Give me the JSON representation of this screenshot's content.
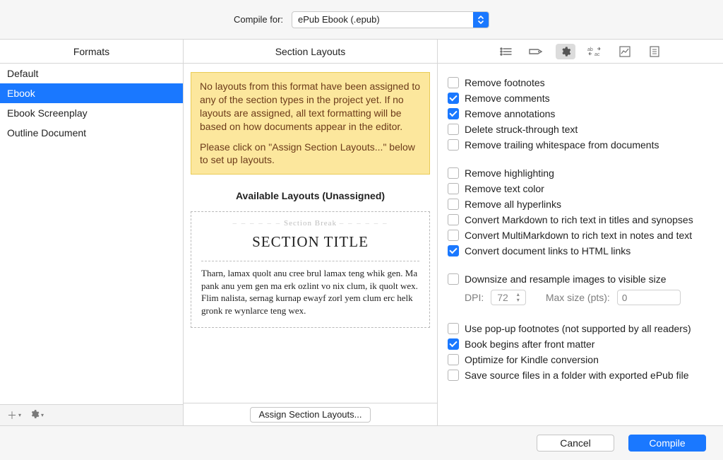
{
  "topbar": {
    "label": "Compile for:",
    "select_value": "ePub Ebook (.epub)"
  },
  "formats": {
    "header": "Formats",
    "items": [
      "Default",
      "Ebook",
      "Ebook Screenplay",
      "Outline Document"
    ],
    "selected_index": 1,
    "add_icon": "plus-icon",
    "gear_icon": "gear-icon"
  },
  "layouts": {
    "header": "Section Layouts",
    "warning_p1": "No layouts from this format have been assigned to any of the section types in the project yet. If no layouts are assigned, all text formatting will be based on how documents appear in the editor.",
    "warning_p2": "Please click on \"Assign Section Layouts...\" below to set up layouts.",
    "available_heading": "Available Layouts (Unassigned)",
    "section_break_label": "Section Break",
    "section_title": "SECTION TITLE",
    "lorem": "Tharn, lamax quolt anu cree brul lamax teng whik gen. Ma pank anu yem gen ma erk ozlint vo nix clum, ik quolt wex. Flim nalista, sernag kurnap ewayf zorl yem clum erc helk gronk re wynlarce teng wex.",
    "assign_button": "Assign Section Layouts..."
  },
  "options": {
    "toolbar_icons": [
      "list-icon",
      "tag-icon",
      "gear-icon",
      "replace-icon",
      "stats-icon",
      "page-icon"
    ],
    "toolbar_selected_index": 2,
    "group1": [
      {
        "label": "Remove footnotes",
        "checked": false
      },
      {
        "label": "Remove comments",
        "checked": true
      },
      {
        "label": "Remove annotations",
        "checked": true
      },
      {
        "label": "Delete struck-through text",
        "checked": false
      },
      {
        "label": "Remove trailing whitespace from documents",
        "checked": false
      }
    ],
    "group2": [
      {
        "label": "Remove highlighting",
        "checked": false
      },
      {
        "label": "Remove text color",
        "checked": false
      },
      {
        "label": "Remove all hyperlinks",
        "checked": false
      },
      {
        "label": "Convert Markdown to rich text in titles and synopses",
        "checked": false
      },
      {
        "label": "Convert MultiMarkdown to rich text in notes and text",
        "checked": false
      },
      {
        "label": "Convert document links to HTML links",
        "checked": true
      }
    ],
    "group3": {
      "downsize": {
        "label": "Downsize and resample images to visible size",
        "checked": false
      },
      "dpi_label": "DPI:",
      "dpi_value": "72",
      "maxsize_label": "Max size (pts):",
      "maxsize_placeholder": "0"
    },
    "group4": [
      {
        "label": "Use pop-up footnotes (not supported by all readers)",
        "checked": false
      },
      {
        "label": "Book begins after front matter",
        "checked": true
      },
      {
        "label": "Optimize for Kindle conversion",
        "checked": false
      },
      {
        "label": "Save source files in a folder with exported ePub file",
        "checked": false
      }
    ]
  },
  "actions": {
    "cancel": "Cancel",
    "compile": "Compile"
  }
}
